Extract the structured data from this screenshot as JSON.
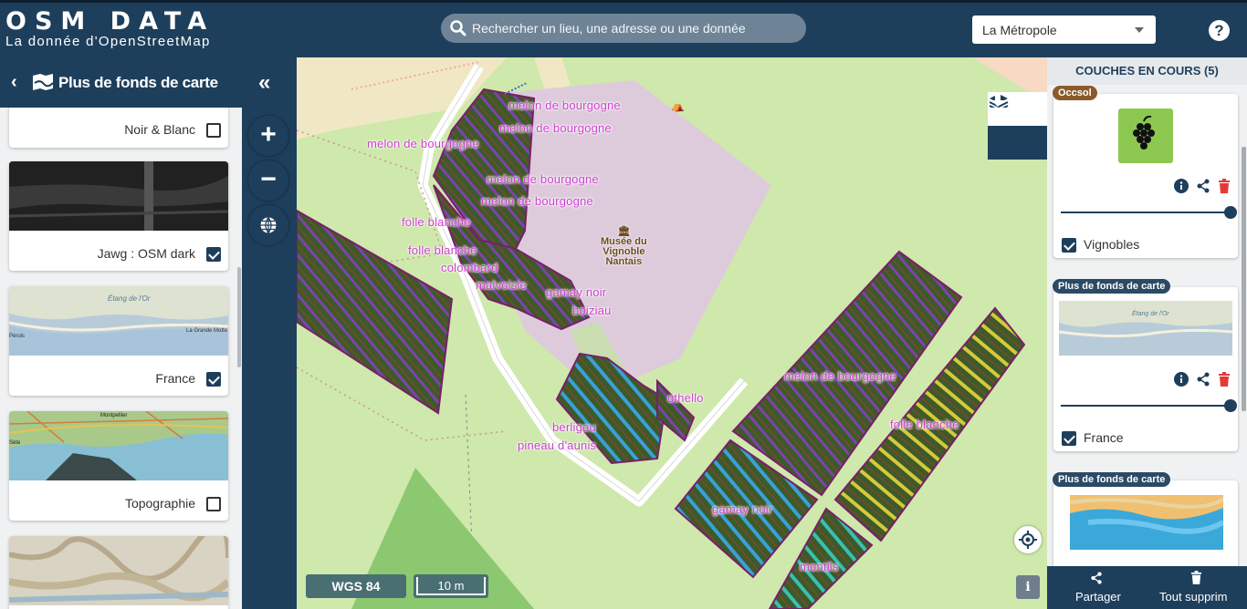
{
  "header": {
    "logo_title": "OSM DATA",
    "logo_subtitle": "La donnée  d'OpenStreetMap",
    "search_placeholder": "Rechercher un lieu, une adresse ou une donnée",
    "region": "La Métropole",
    "help_label": "?"
  },
  "sidebar": {
    "title": "Plus de fonds de carte",
    "items": [
      {
        "label": "Noir & Blanc",
        "checked": false
      },
      {
        "label": "Jawg : OSM dark",
        "checked": true
      },
      {
        "label": "France",
        "checked": true
      },
      {
        "label": "Topographie",
        "checked": false
      },
      {
        "label": "",
        "checked": false
      }
    ],
    "thumb_texts": {
      "etang": "Étang de l'Or",
      "grande_motte": "La Grande Motte",
      "perols": "Pérols",
      "montpellier": "Montpellier",
      "sete": "Sète"
    }
  },
  "map": {
    "labels": [
      "melon de bourgogne",
      "melon de bourgogne",
      "melon de bourgogne",
      "melon de bourgogne",
      "melon de bourgogne",
      "folle blanche",
      "folle blanche",
      "colombard",
      "malvoisie",
      "gamay noir",
      "boiziau",
      "othello",
      "berligou",
      "pineau d'aunis",
      "melon de bourgogne",
      "folle blanche",
      "gamay noir",
      "montils"
    ],
    "poi": [
      "Musée du",
      "Vignoble",
      "Nantais"
    ],
    "crs": "WGS 84",
    "scale": "10 m",
    "info": "i"
  },
  "right_panel": {
    "title": "COUCHES EN COURS (5)",
    "layers": [
      {
        "tag": "Occsol",
        "tag_color": "#8b5a2b",
        "name": "Vignobles",
        "checked": true,
        "opacity": 1.0
      },
      {
        "tag": "Plus de fonds de carte",
        "tag_color": "#2c4a66",
        "name": "France",
        "checked": true,
        "opacity": 1.0
      },
      {
        "tag": "Plus de fonds de carte",
        "tag_color": "#2c4a66",
        "name": "",
        "checked": true,
        "opacity": 1.0
      }
    ],
    "footer": {
      "share": "Partager",
      "delete_all": "Tout supprim"
    }
  },
  "colors": {
    "primary": "#1e3f5c",
    "map_bg": "#cfe8ac",
    "vineyard": "#3c5a2a",
    "label": "#ce3fd0",
    "trash": "#e53935"
  }
}
